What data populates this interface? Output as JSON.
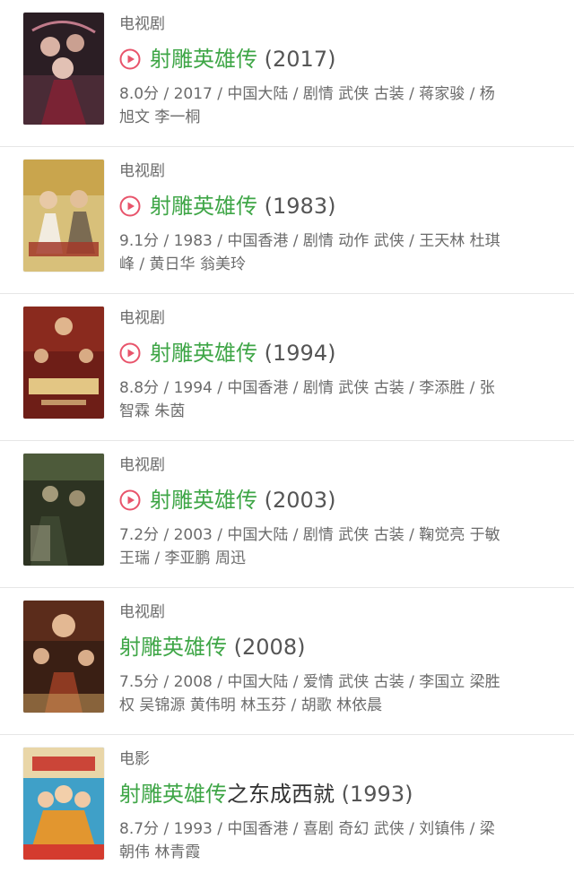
{
  "accent_color": "#3fa647",
  "play_icon_color": "#e8546b",
  "items": [
    {
      "type": "电视剧",
      "title_highlight": "射雕英雄传",
      "title_tail": "",
      "year": "(2017)",
      "meta_line1": "8.0分 / 2017 / 中国大陆 / 剧情 武侠 古装 / 蒋家骏 / 杨",
      "meta_line2": "旭文 李一桐",
      "has_play_icon": true,
      "poster_icon": "poster-image"
    },
    {
      "type": "电视剧",
      "title_highlight": "射雕英雄传",
      "title_tail": "",
      "year": "(1983)",
      "meta_line1": "9.1分 / 1983 / 中国香港 / 剧情 动作 武侠 / 王天林 杜琪",
      "meta_line2": "峰 / 黄日华 翁美玲",
      "has_play_icon": true,
      "poster_icon": "poster-image"
    },
    {
      "type": "电视剧",
      "title_highlight": "射雕英雄传",
      "title_tail": "",
      "year": "(1994)",
      "meta_line1": "8.8分 / 1994 / 中国香港 / 剧情 武侠 古装 / 李添胜 / 张",
      "meta_line2": "智霖 朱茵",
      "has_play_icon": true,
      "poster_icon": "poster-image"
    },
    {
      "type": "电视剧",
      "title_highlight": "射雕英雄传",
      "title_tail": "",
      "year": "(2003)",
      "meta_line1": "7.2分 / 2003 / 中国大陆 / 剧情 武侠 古装 / 鞠觉亮 于敏",
      "meta_line2": "王瑞 / 李亚鹏 周迅",
      "has_play_icon": true,
      "poster_icon": "poster-image"
    },
    {
      "type": "电视剧",
      "title_highlight": "射雕英雄传",
      "title_tail": "",
      "year": "(2008)",
      "meta_line1": "7.5分 / 2008 / 中国大陆 / 爱情 武侠 古装 / 李国立 梁胜",
      "meta_line2": "权 吴锦源 黄伟明 林玉芬 / 胡歌 林依晨",
      "has_play_icon": false,
      "poster_icon": "poster-image"
    },
    {
      "type": "电影",
      "title_highlight": "射雕英雄传",
      "title_tail": "之东成西就",
      "year": "(1993)",
      "meta_line1": "8.7分 / 1993 / 中国香港 / 喜剧 奇幻 武侠 / 刘镇伟 / 梁",
      "meta_line2": "朝伟 林青霞",
      "has_play_icon": false,
      "poster_icon": "poster-image"
    }
  ]
}
